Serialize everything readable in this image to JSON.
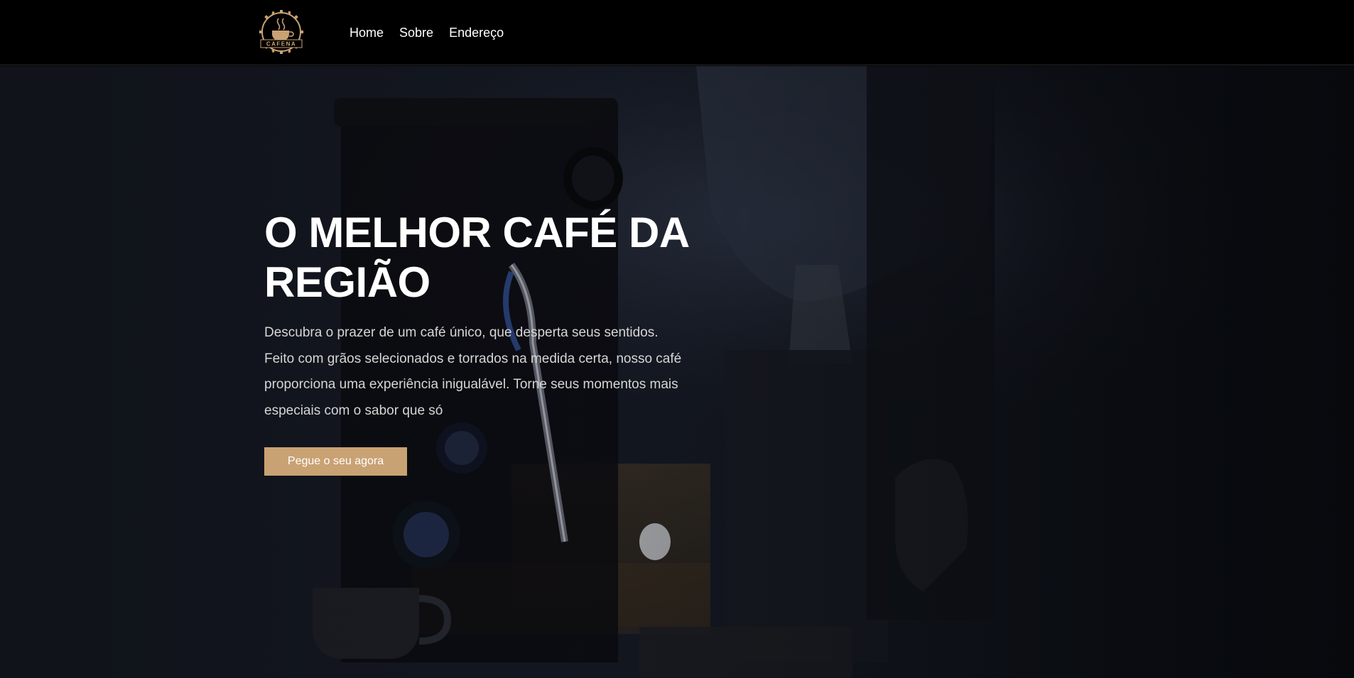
{
  "brand": {
    "logo_text": "CAFENA",
    "accent_color": "#c9a273"
  },
  "nav": {
    "items": [
      {
        "label": "Home"
      },
      {
        "label": "Sobre"
      },
      {
        "label": "Endereço"
      }
    ]
  },
  "hero": {
    "title": "O MELHOR CAFÉ DA REGIÃO",
    "description": "Descubra o prazer de um café único, que desperta seus sentidos. Feito com grãos selecionados e torrados na medida certa, nosso café proporciona uma experiência inigualável. Torne seus momentos mais especiais com o sabor que só",
    "cta_label": "Pegue o seu agora",
    "background_icon": "espresso-machine-photo"
  }
}
